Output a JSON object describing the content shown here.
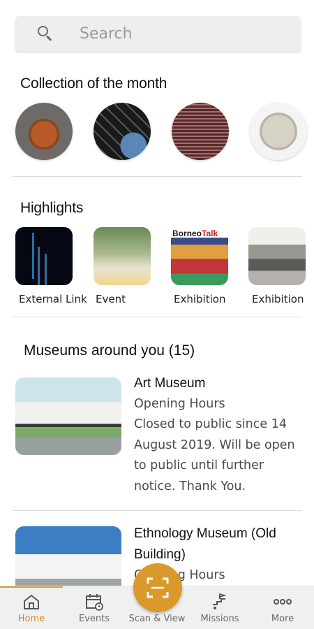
{
  "search": {
    "placeholder": "Search"
  },
  "collection": {
    "title": "Collection of the month",
    "items": [
      {
        "icon": "woven-basket-photo"
      },
      {
        "icon": "beaded-textile-photo"
      },
      {
        "icon": "woven-textile-photo"
      },
      {
        "icon": "woven-vessel-photo"
      }
    ]
  },
  "highlights": {
    "title": "Highlights",
    "items": [
      {
        "label": "External Link"
      },
      {
        "label": "Event"
      },
      {
        "label": "Exhibition"
      },
      {
        "label": "Exhibition"
      }
    ],
    "borneo_talk": {
      "part1": "Borneo",
      "part2": "Talk"
    }
  },
  "museums": {
    "title": "Museums around you (15)",
    "list": [
      {
        "name": "Art Museum",
        "hours_label": "Opening Hours",
        "status": "Closed to public since 14 August 2019. Will be open to public until further notice. Thank You."
      },
      {
        "name": "Ethnology Museum (Old Building)",
        "hours_label": "Opening Hours"
      }
    ]
  },
  "tabbar": {
    "tabs": [
      {
        "label": "Home",
        "icon": "home-icon",
        "active": true
      },
      {
        "label": "Events",
        "icon": "calendar-icon",
        "active": false
      },
      {
        "label": "Scan & View",
        "icon": "scan-icon",
        "active": false
      },
      {
        "label": "Missions",
        "icon": "missions-icon",
        "active": false
      },
      {
        "label": "More",
        "icon": "more-icon",
        "active": false
      }
    ]
  },
  "colors": {
    "accent": "#d99a2b",
    "active_label": "#d48a1c",
    "tabbar_bg": "#f0f0f0"
  }
}
